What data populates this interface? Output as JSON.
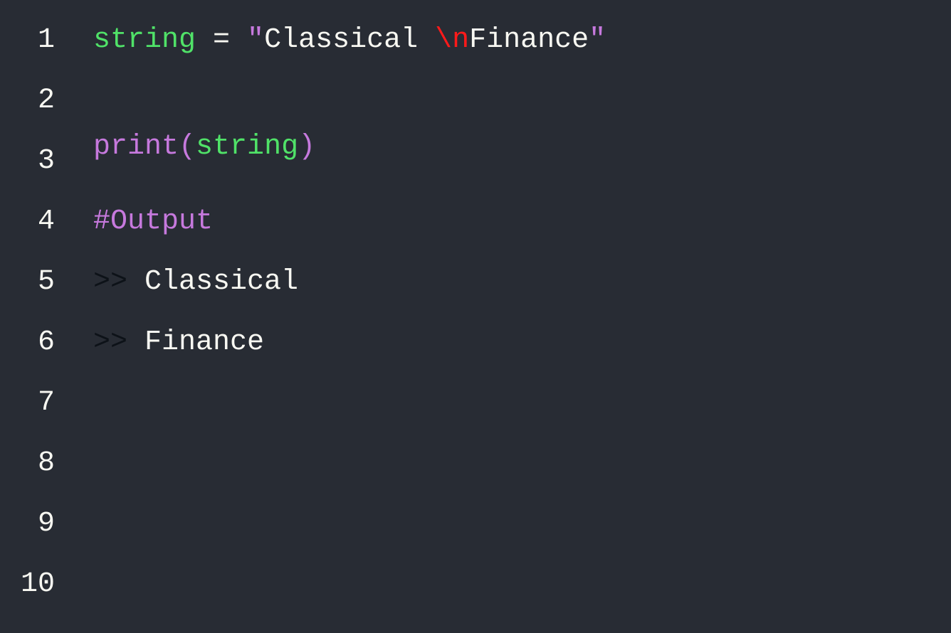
{
  "gutter": {
    "numbers": [
      "1",
      "2",
      "3",
      "4",
      "5",
      "6",
      "7",
      "8",
      "9",
      "10"
    ]
  },
  "code": {
    "line1": {
      "var": "string",
      "eq": " = ",
      "q1": "\"",
      "str1": "Classical ",
      "esc": "\\n",
      "str2": "Finance",
      "q2": "\""
    },
    "line3": {
      "fn": "print",
      "paren1": "(",
      "arg": "string",
      "paren2": ")"
    },
    "line4": {
      "comment": "#Output"
    },
    "line5": {
      "prompt": ">>",
      "text": " Classical"
    },
    "line6": {
      "prompt": ">>",
      "text": " Finance"
    }
  }
}
